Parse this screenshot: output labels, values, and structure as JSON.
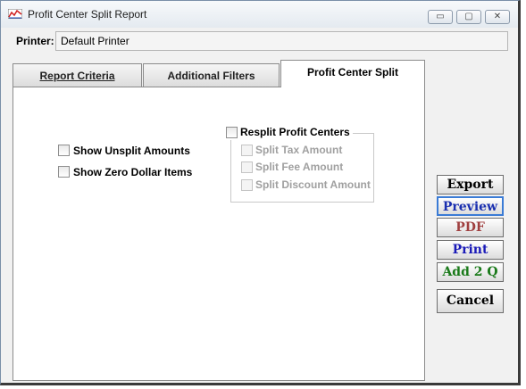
{
  "window": {
    "title": "Profit Center Split Report",
    "controls": {
      "minimize": "▭",
      "maximize": "▢",
      "close": "✕"
    }
  },
  "printer": {
    "label": "Printer:",
    "value": "Default Printer"
  },
  "tabs": [
    {
      "label": "Report Criteria",
      "active": false
    },
    {
      "label": "Additional Filters",
      "active": false
    },
    {
      "label": "Profit Center Split",
      "active": true
    }
  ],
  "options": {
    "show_unsplit": "Show Unsplit Amounts",
    "show_zero": "Show Zero Dollar Items"
  },
  "resplit": {
    "title": "Resplit Profit Centers",
    "items": [
      "Split Tax Amount",
      "Split Fee Amount",
      "Split Discount Amount"
    ]
  },
  "buttons": {
    "export": "Export",
    "preview": "Preview",
    "pdf": "PDF",
    "print": "Print",
    "add2q": "Add 2 Q",
    "cancel": "Cancel"
  },
  "colors": {
    "export": "#000000",
    "preview": "#1a2fb0",
    "pdf": "#a04040",
    "print": "#1a1ab8",
    "add2q": "#1a7a1a",
    "cancel": "#000000"
  }
}
